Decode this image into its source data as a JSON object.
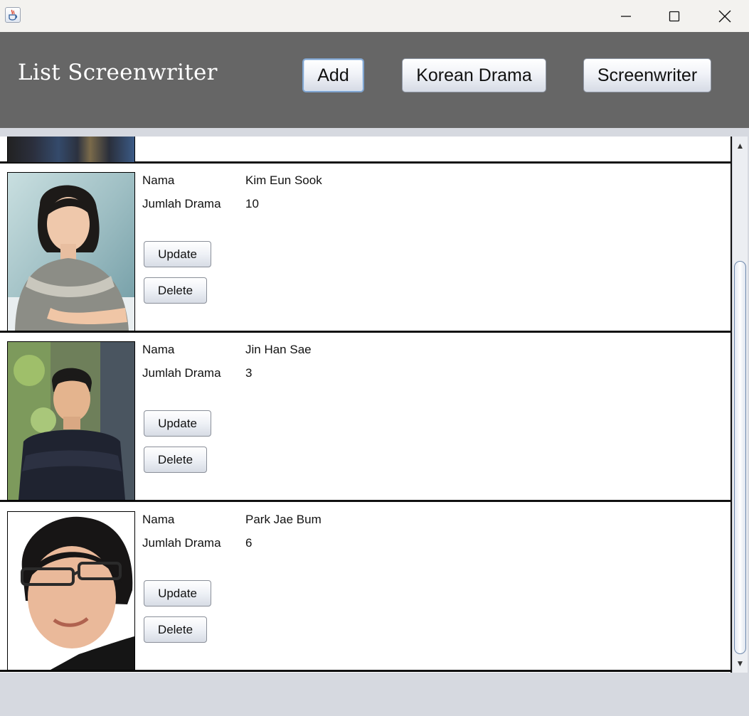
{
  "window": {
    "icon": "java-cup-icon",
    "controls": {
      "minimize": "minimize-icon",
      "maximize": "maximize-icon",
      "close": "close-icon"
    }
  },
  "header": {
    "title": "List Screenwriter",
    "buttons": {
      "add": "Add",
      "korean_drama": "Korean Drama",
      "screenwriter": "Screenwriter"
    }
  },
  "labels": {
    "name": "Nama",
    "count": "Jumlah Drama",
    "update": "Update",
    "delete": "Delete"
  },
  "writers": [
    {
      "name": "Kim Eun Sook",
      "count": "10"
    },
    {
      "name": "Jin Han Sae",
      "count": "3"
    },
    {
      "name": "Park Jae Bum",
      "count": "6"
    }
  ],
  "colors": {
    "header_bg": "#666666",
    "window_bg": "#d6d9e0",
    "focused_border": "#7fa4cf"
  }
}
